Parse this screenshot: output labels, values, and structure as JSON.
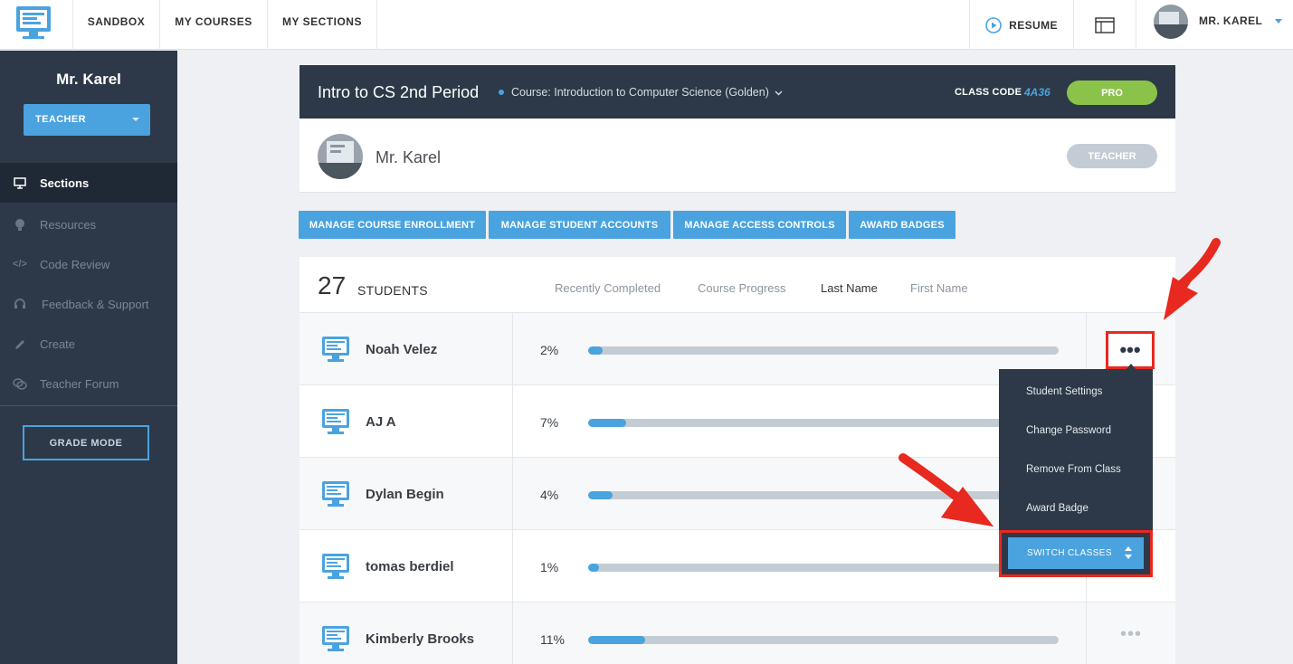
{
  "nav": {
    "items": [
      "SANDBOX",
      "MY COURSES",
      "MY SECTIONS"
    ],
    "resume_label": "RESUME",
    "user_label": "MR. KAREL"
  },
  "sidebar": {
    "name": "Mr. Karel",
    "role": "TEACHER",
    "items": [
      {
        "label": "Sections",
        "icon": "monitor-icon",
        "active": true
      },
      {
        "label": "Resources",
        "icon": "lightbulb-icon",
        "active": false
      },
      {
        "label": "Code Review",
        "icon": "code-icon",
        "active": false
      },
      {
        "label": "Feedback & Support",
        "icon": "headset-icon",
        "active": false
      },
      {
        "label": "Create",
        "icon": "pencil-icon",
        "active": false
      },
      {
        "label": "Teacher Forum",
        "icon": "chat-icon",
        "active": false
      }
    ],
    "grade_mode": "GRADE MODE"
  },
  "class": {
    "title": "Intro to CS 2nd Period",
    "course": "Course: Introduction to Computer Science (Golden)",
    "code_label": "CLASS CODE",
    "code": "4A36",
    "plan": "PRO"
  },
  "teacher": {
    "name": "Mr. Karel",
    "role": "TEACHER"
  },
  "actions": [
    "MANAGE COURSE ENROLLMENT",
    "MANAGE STUDENT ACCOUNTS",
    "MANAGE ACCESS CONTROLS",
    "AWARD BADGES"
  ],
  "students": {
    "count": "27",
    "label": "STUDENTS",
    "sort_options": [
      "Recently Completed",
      "Course Progress",
      "Last Name",
      "First Name"
    ],
    "active_sort": "Last Name",
    "rows": [
      {
        "name": "Noah Velez",
        "percent": "2%",
        "progress": 0.02
      },
      {
        "name": "AJ A",
        "percent": "7%",
        "progress": 0.07
      },
      {
        "name": "Dylan Begin",
        "percent": "4%",
        "progress": 0.04
      },
      {
        "name": "tomas berdiel",
        "percent": "1%",
        "progress": 0.01
      },
      {
        "name": "Kimberly Brooks",
        "percent": "11%",
        "progress": 0.11
      }
    ]
  },
  "menu": {
    "items": [
      "Student Settings",
      "Change Password",
      "Remove From Class",
      "Award Badge"
    ],
    "switch_label": "SWITCH CLASSES"
  },
  "colors": {
    "accent": "#4aa3df",
    "dark": "#2d3948",
    "pro": "#8bc34a",
    "annotation": "#e8291f"
  }
}
